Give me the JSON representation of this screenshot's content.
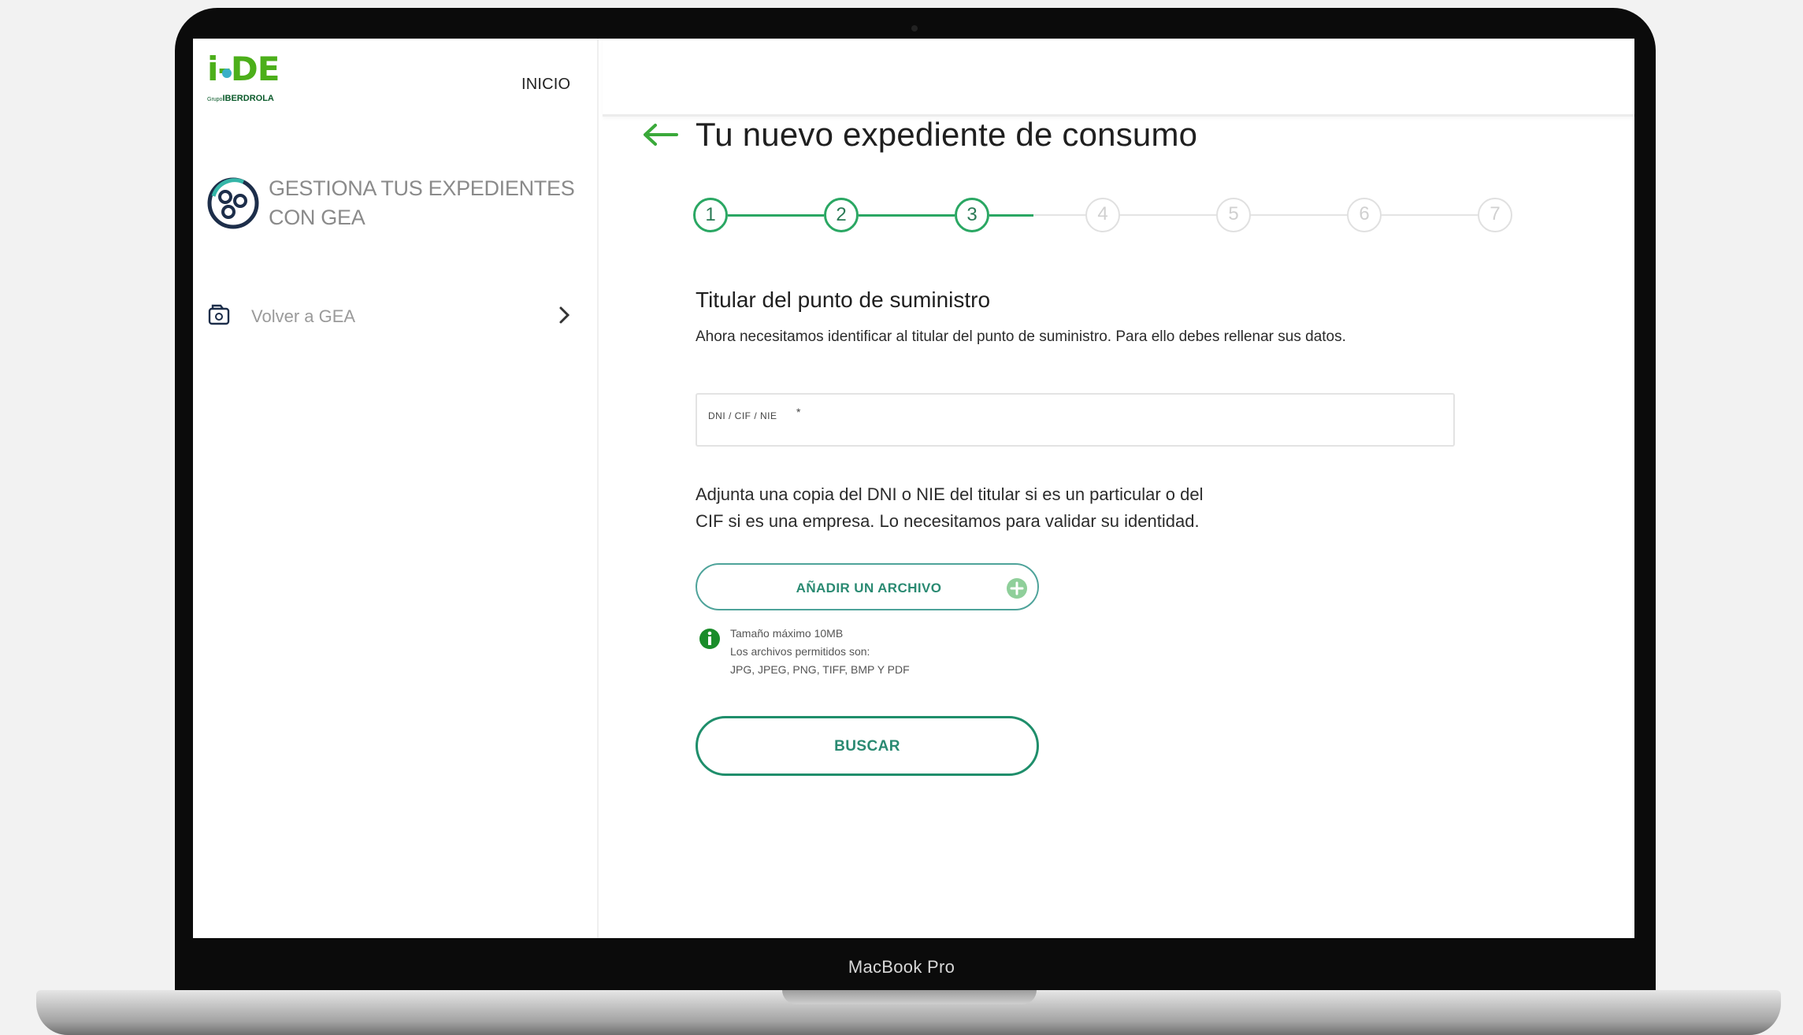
{
  "device": {
    "label": "MacBook Pro"
  },
  "sidebar": {
    "logo": {
      "main": "i-DE",
      "sub_small": "Grupo",
      "sub": "IBERDROLA"
    },
    "nav_home": "INICIO",
    "section_title_line1": "GESTIONA TUS EXPEDIENTES",
    "section_title_line2": "CON GEA",
    "back_link": "Volver a GEA"
  },
  "main": {
    "title": "Tu nuevo expediente de consumo",
    "stepper": {
      "steps": [
        "1",
        "2",
        "3",
        "4",
        "5",
        "6",
        "7"
      ],
      "current_step": 3
    },
    "section_title": "Titular del punto de suministro",
    "section_description": "Ahora necesitamos identificar al titular del punto de suministro. Para ello debes rellenar sus datos.",
    "id_field": {
      "label": "DNI / CIF / NIE",
      "required_mark": "*",
      "value": ""
    },
    "attach_text_line1": "Adjunta una copia del DNI o NIE del titular si es un particular o del",
    "attach_text_line2": "CIF si es una empresa. Lo necesitamos para validar su identidad.",
    "add_file_button": "AÑADIR UN ARCHIVO",
    "file_info": {
      "line1": "Tamaño máximo 10MB",
      "line2": "Los archivos permitidos son:",
      "line3": "JPG, JPEG, PNG, TIFF, BMP Y PDF"
    },
    "search_button": "BUSCAR"
  },
  "colors": {
    "brand_green": "#4caf1a",
    "accent_teal": "#2a8a72",
    "step_active": "#2aa763",
    "step_inactive": "#e0e0e0"
  }
}
